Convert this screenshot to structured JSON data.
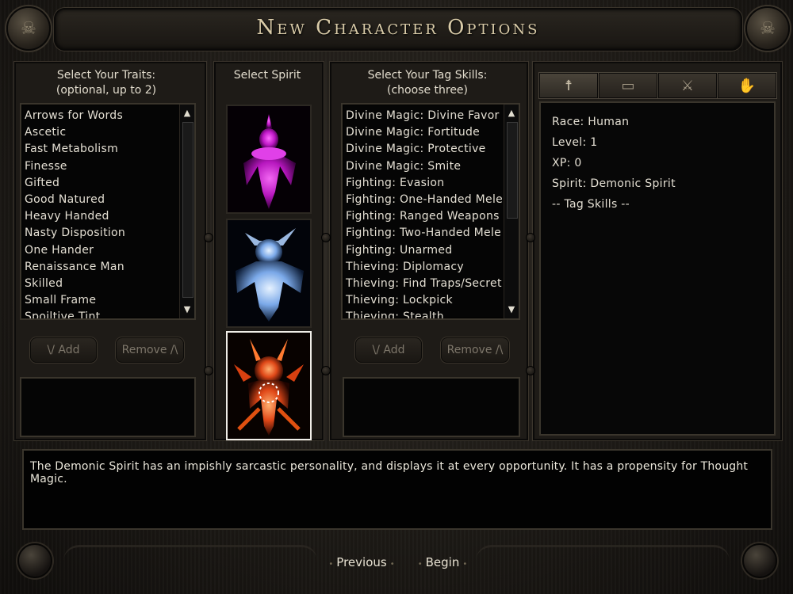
{
  "title": "New Character Options",
  "traits": {
    "heading": "Select Your Traits:\n(optional, up to 2)",
    "items": [
      "Arrows for Words",
      "Ascetic",
      "Fast Metabolism",
      "Finesse",
      "Gifted",
      "Good Natured",
      "Heavy Handed",
      "Nasty Disposition",
      "One Hander",
      "Renaissance Man",
      "Skilled",
      "Small Frame",
      "Spoiltive Tint"
    ],
    "add_label": "\\/ Add",
    "remove_label": "Remove /\\"
  },
  "spirit": {
    "heading": "Select Spirit",
    "portraits": [
      "Magenta Spirit",
      "Blue Spirit",
      "Demonic Spirit"
    ]
  },
  "tag_skills": {
    "heading": "Select Your Tag Skills:\n(choose three)",
    "items": [
      "Divine Magic: Divine Favor",
      "Divine Magic: Fortitude",
      "Divine Magic: Protective",
      "Divine Magic: Smite",
      "Fighting: Evasion",
      "Fighting: One-Handed Mele",
      "Fighting: Ranged Weapons",
      "Fighting: Two-Handed Mele",
      "Fighting: Unarmed",
      "Thieving: Diplomacy",
      "Thieving: Find Traps/Secret I",
      "Thieving: Lockpick",
      "Thieving: Stealth"
    ],
    "add_label": "\\/ Add",
    "remove_label": "Remove /\\"
  },
  "tabs": [
    {
      "icon": "figure-icon",
      "glyph": "☨"
    },
    {
      "icon": "scroll-icon",
      "glyph": "▭"
    },
    {
      "icon": "sword-icon",
      "glyph": "⚔"
    },
    {
      "icon": "hand-icon",
      "glyph": "✋"
    }
  ],
  "stats": {
    "race": "Race:  Human",
    "level": "Level:  1",
    "xp": "XP:   0",
    "spirit": "Spirit:  Demonic Spirit",
    "tag_skills": "-- Tag Skills --"
  },
  "description": "The Demonic Spirit has an impishly sarcastic personality, and displays it at every opportunity. It has a propensity for Thought Magic.",
  "buttons": {
    "previous": "Previous",
    "begin": "Begin"
  }
}
